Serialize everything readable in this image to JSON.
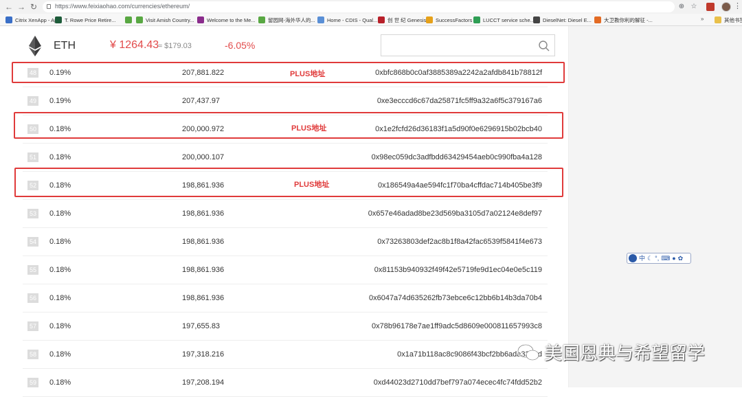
{
  "browser": {
    "url": "https://www.feixiaohao.com/currencies/ethereum/",
    "bookmarks": [
      {
        "label": "Citrix XenApp - Ap...",
        "color": "#3a6fc7"
      },
      {
        "label": "T. Rowe Price Retire...",
        "color": "#1d5c3a"
      },
      {
        "label": "",
        "color": "#59a843"
      },
      {
        "label": "Visit Amish Country...",
        "color": "#59a843"
      },
      {
        "label": "Welcome to the Me...",
        "color": "#8a2c8c"
      },
      {
        "label": "留园网-海外华人的...",
        "color": "#59a843"
      },
      {
        "label": "Home - CDIS - Qual...",
        "color": "#5a8fd6"
      },
      {
        "label": "创 世 纪 Genesis",
        "color": "#b8202a"
      },
      {
        "label": "SuccessFactors",
        "color": "#e6a11a"
      },
      {
        "label": "LUCCT service sche...",
        "color": "#2f9e55"
      },
      {
        "label": "DieselNet: Diesel E...",
        "color": "#444444"
      },
      {
        "label": "大卫教你利的解征 -...",
        "color": "#e36b24"
      }
    ],
    "bookmarks_more": "»",
    "other_bookmarks": "其他书签"
  },
  "header": {
    "coin_symbol": "ETH",
    "price_cny": "¥ 1264.43",
    "price_usd": "≈ $179.03",
    "change": "-6.05%"
  },
  "holders": [
    {
      "rank": "48",
      "pct": "0.19%",
      "qty": "207,881.822",
      "addr": "0xbfc868b0c0af3885389a2242a2afdb841b78812f"
    },
    {
      "rank": "49",
      "pct": "0.19%",
      "qty": "207,437.97",
      "addr": "0xe3ecccd6c67da25871fc5ff9a32a6f5c379167a6"
    },
    {
      "rank": "50",
      "pct": "0.18%",
      "qty": "200,000.972",
      "addr": "0x1e2fcfd26d36183f1a5d90f0e6296915b02bcb40"
    },
    {
      "rank": "51",
      "pct": "0.18%",
      "qty": "200,000.107",
      "addr": "0x98ec059dc3adfbdd63429454aeb0c990fba4a128"
    },
    {
      "rank": "52",
      "pct": "0.18%",
      "qty": "198,861.936",
      "addr": "0x186549a4ae594fc1f70ba4cffdac714b405be3f9"
    },
    {
      "rank": "53",
      "pct": "0.18%",
      "qty": "198,861.936",
      "addr": "0x657e46adad8be23d569ba3105d7a02124e8def97"
    },
    {
      "rank": "54",
      "pct": "0.18%",
      "qty": "198,861.936",
      "addr": "0x73263803def2ac8b1f8a42fac6539f5841f4e673"
    },
    {
      "rank": "55",
      "pct": "0.18%",
      "qty": "198,861.936",
      "addr": "0x81153b940932f49f42e5719fe9d1ec04e0e5c119"
    },
    {
      "rank": "56",
      "pct": "0.18%",
      "qty": "198,861.936",
      "addr": "0x6047a74d635262fb73ebce6c12bb6b14b3da70b4"
    },
    {
      "rank": "57",
      "pct": "0.18%",
      "qty": "197,655.83",
      "addr": "0x78b96178e7ae1ff9adc5d8609e000811657993c8"
    },
    {
      "rank": "58",
      "pct": "0.18%",
      "qty": "197,318.216",
      "addr": "0x1a71b118ac8c9086f43bcf2bb6ada3393d"
    },
    {
      "rank": "59",
      "pct": "0.18%",
      "qty": "197,208.194",
      "addr": "0xd44023d2710dd7bef797a074ecec4fc74fdd52b2"
    }
  ],
  "annotations": {
    "plus_label": "PLUS地址"
  },
  "watermark": "美国恩典与希望留学"
}
